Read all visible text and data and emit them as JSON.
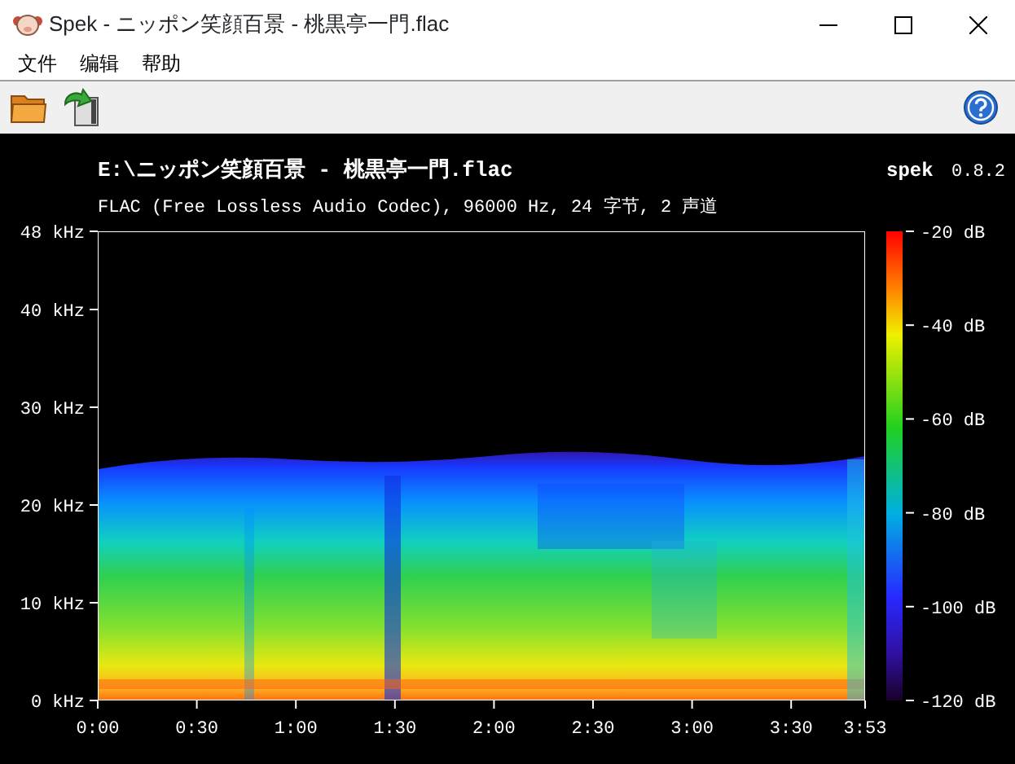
{
  "window": {
    "title": "Spek - ニッポン笑顔百景 - 桃黒亭一門.flac"
  },
  "menu": [
    "文件",
    "编辑",
    "帮助"
  ],
  "plot": {
    "file_path": "E:\\ニッポン笑顔百景 - 桃黒亭一門.flac",
    "app_name": "spek",
    "version": "0.8.2",
    "info": "FLAC (Free Lossless Audio Codec), 96000 Hz, 24 字节, 2 声道",
    "frequency_ticks": [
      "48 kHz",
      "40 kHz",
      "30 kHz",
      "20 kHz",
      "10 kHz",
      "0 kHz"
    ],
    "time_ticks": [
      "0:00",
      "0:30",
      "1:00",
      "1:30",
      "2:00",
      "2:30",
      "3:00",
      "3:30",
      "3:53"
    ],
    "db_ticks": [
      "-20 dB",
      "-40 dB",
      "-60 dB",
      "-80 dB",
      "-100 dB",
      "-120 dB"
    ]
  }
}
